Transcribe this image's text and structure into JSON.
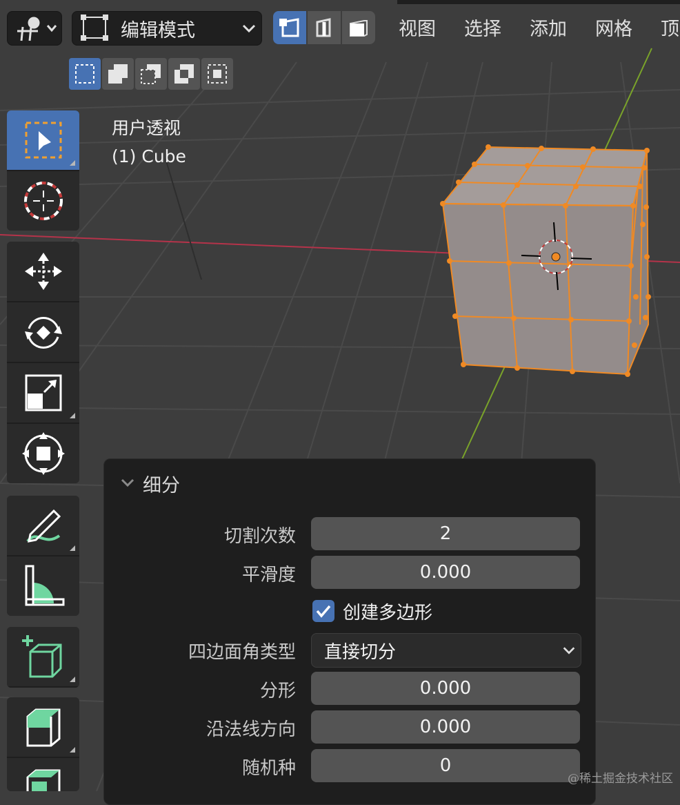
{
  "header": {
    "mode_label": "编辑模式",
    "menu": [
      "视图",
      "选择",
      "添加",
      "网格",
      "顶"
    ]
  },
  "overlay": {
    "view_name": "用户透视",
    "object_name": "(1) Cube"
  },
  "panel": {
    "title": "细分",
    "number_of_cuts_label": "切割次数",
    "number_of_cuts": "2",
    "smoothness_label": "平滑度",
    "smoothness": "0.000",
    "create_ngons_label": "创建多边形",
    "create_ngons": true,
    "quad_corner_label": "四边面角类型",
    "quad_corner_value": "直接切分",
    "fractal_label": "分形",
    "fractal": "0.000",
    "along_normal_label": "沿法线方向",
    "along_normal": "0.000",
    "random_seed_label": "随机种",
    "random_seed": "0"
  },
  "watermark": "@稀土掘金技术社区",
  "colors": {
    "selection_orange": "#f08a24",
    "accent_blue": "#4772b3",
    "x_axis": "#b5334a",
    "y_axis": "#7aa32a"
  },
  "icons": {
    "tools": [
      "select-box-icon",
      "cursor-icon",
      "move-icon",
      "rotate-icon",
      "scale-icon",
      "transform-icon",
      "annotate-icon",
      "measure-icon",
      "add-cube-icon",
      "extrude-icon",
      "inset-icon"
    ]
  }
}
